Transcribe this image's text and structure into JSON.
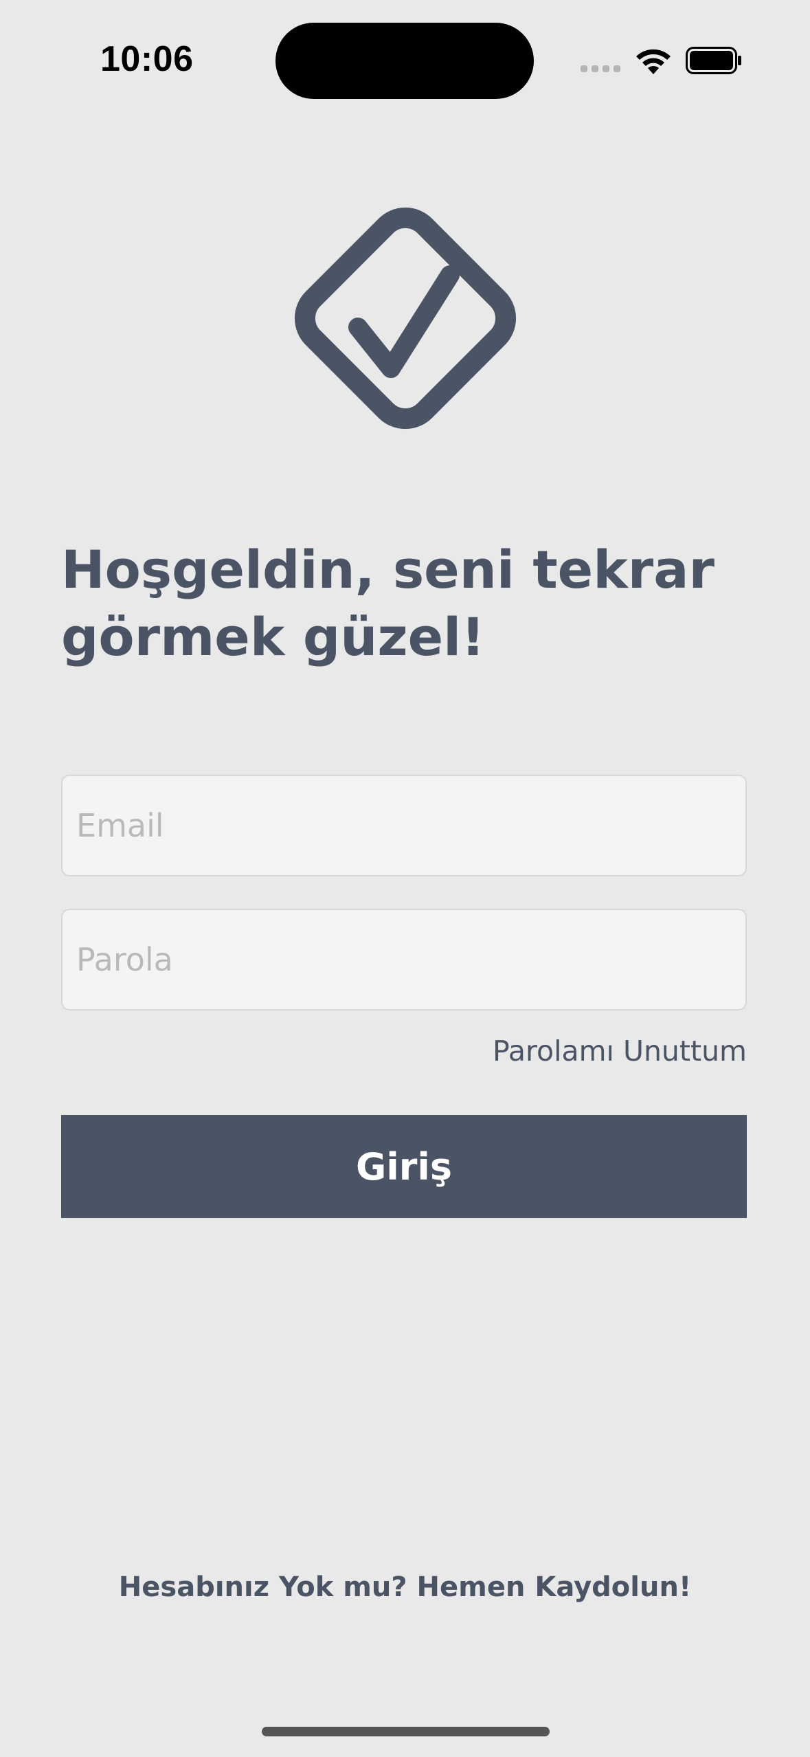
{
  "status_bar": {
    "time": "10:06",
    "icons": [
      "cellular-signal-icon",
      "wifi-icon",
      "battery-icon"
    ]
  },
  "logo": {
    "icon": "checkmark-diamond-icon",
    "color": "#4a5464"
  },
  "heading": "Hoşgeldin, seni tekrar görmek güzel!",
  "form": {
    "email_placeholder": "Email",
    "email_value": "",
    "password_placeholder": "Parola",
    "password_value": "",
    "forgot_password": "Parolamı Unuttum",
    "login_button": "Giriş"
  },
  "signup_link": "Hesabınız Yok mu? Hemen Kaydolun!",
  "colors": {
    "background": "#e9e9e9",
    "primary": "#4a5464",
    "input_background": "#f4f4f2",
    "placeholder": "#b9b9b9"
  }
}
